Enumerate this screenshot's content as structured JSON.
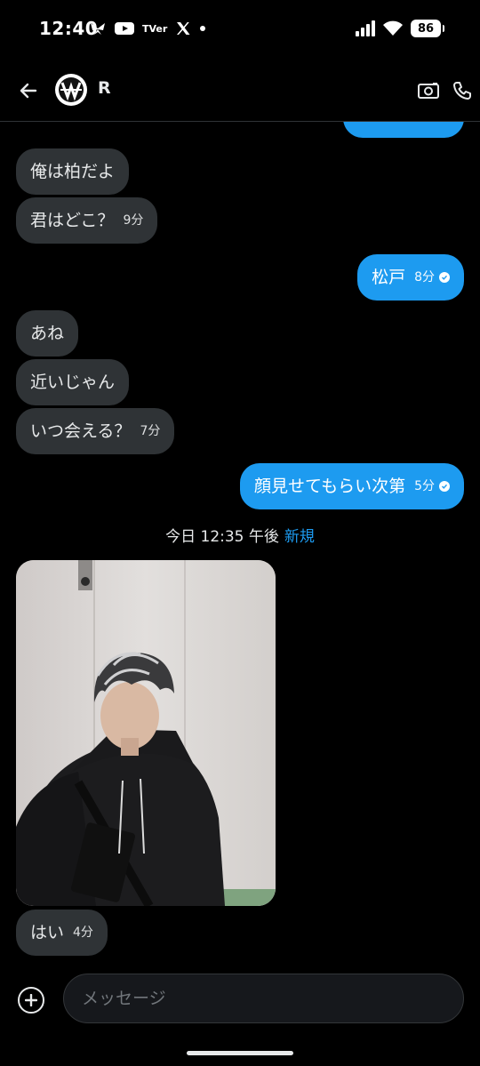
{
  "status_bar": {
    "time": "12:40",
    "battery": "86",
    "tv_label": "TVer"
  },
  "header": {
    "contact_name": "R",
    "back_icon": "arrow-left-icon",
    "video_icon": "video-camera-icon",
    "call_icon": "phone-icon"
  },
  "messages": [
    {
      "text": "俺は柏だよ",
      "time": ""
    },
    {
      "text": "君はどこ？",
      "time": "9分"
    },
    {
      "text": "松戸",
      "time": "8分"
    },
    {
      "text": "あね",
      "time": ""
    },
    {
      "text": "近いじゃん",
      "time": ""
    },
    {
      "text": "いつ会える？",
      "time": "7分"
    },
    {
      "text": "顔見せてもらい次第",
      "time": "5分"
    },
    {
      "text": "はい",
      "time": "4分"
    }
  ],
  "divider": {
    "label": "今日 12:35 午後",
    "new_label": "新規"
  },
  "composer": {
    "placeholder": "メッセージ"
  },
  "colors": {
    "accent": "#1d9bf0",
    "incoming": "#2f3336",
    "background": "#000000"
  }
}
